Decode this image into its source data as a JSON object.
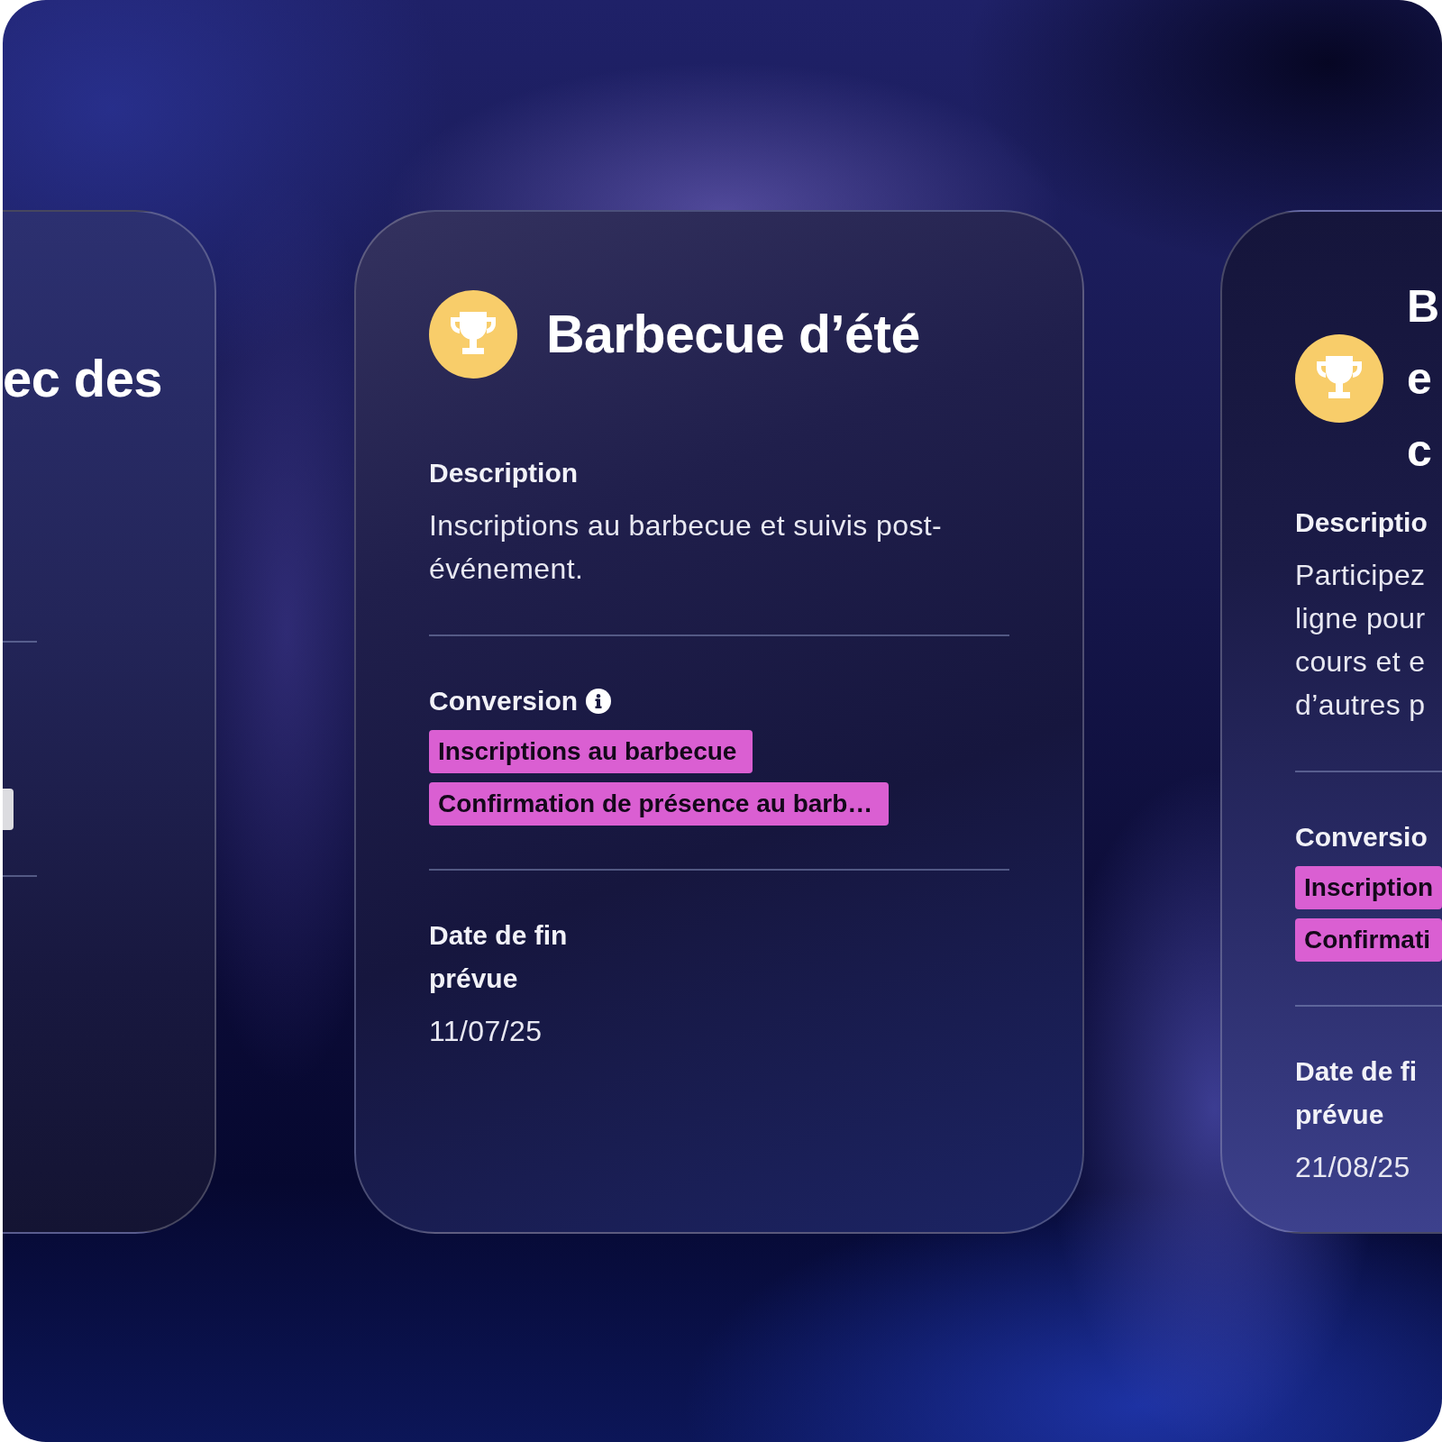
{
  "cards": [
    {
      "kind": "partial-left",
      "title_lines": [
        "ec des"
      ],
      "tags": [
        {
          "color": "#dcdce0"
        }
      ]
    },
    {
      "kind": "full",
      "title": "Barbecue d’été",
      "description_label": "Description",
      "description": "Inscriptions au barbecue et suivis post-événement.",
      "conversion_label": "Conversion",
      "tags": [
        {
          "label": "Inscriptions au barbecue",
          "color": "#da5fd2"
        },
        {
          "label": "Confirmation de présence au barb…",
          "color": "#da5fd2"
        }
      ],
      "end_date_label": "Date de fin prévue",
      "end_date": "11/07/25"
    },
    {
      "kind": "partial-right",
      "title_lines": [
        "B",
        "e",
        "c"
      ],
      "description_label": "Descriptio",
      "description_lines": [
        "Participez",
        "ligne pour",
        "cours et e",
        "d’autres p"
      ],
      "conversion_label": "Conversio",
      "tags": [
        {
          "label": "Inscription",
          "color": "#da5fd2"
        },
        {
          "label": "Confirmati",
          "color": "#da5fd2"
        }
      ],
      "end_date_label_lines": [
        "Date de fi",
        "prévue"
      ],
      "end_date": "21/08/25"
    }
  ]
}
